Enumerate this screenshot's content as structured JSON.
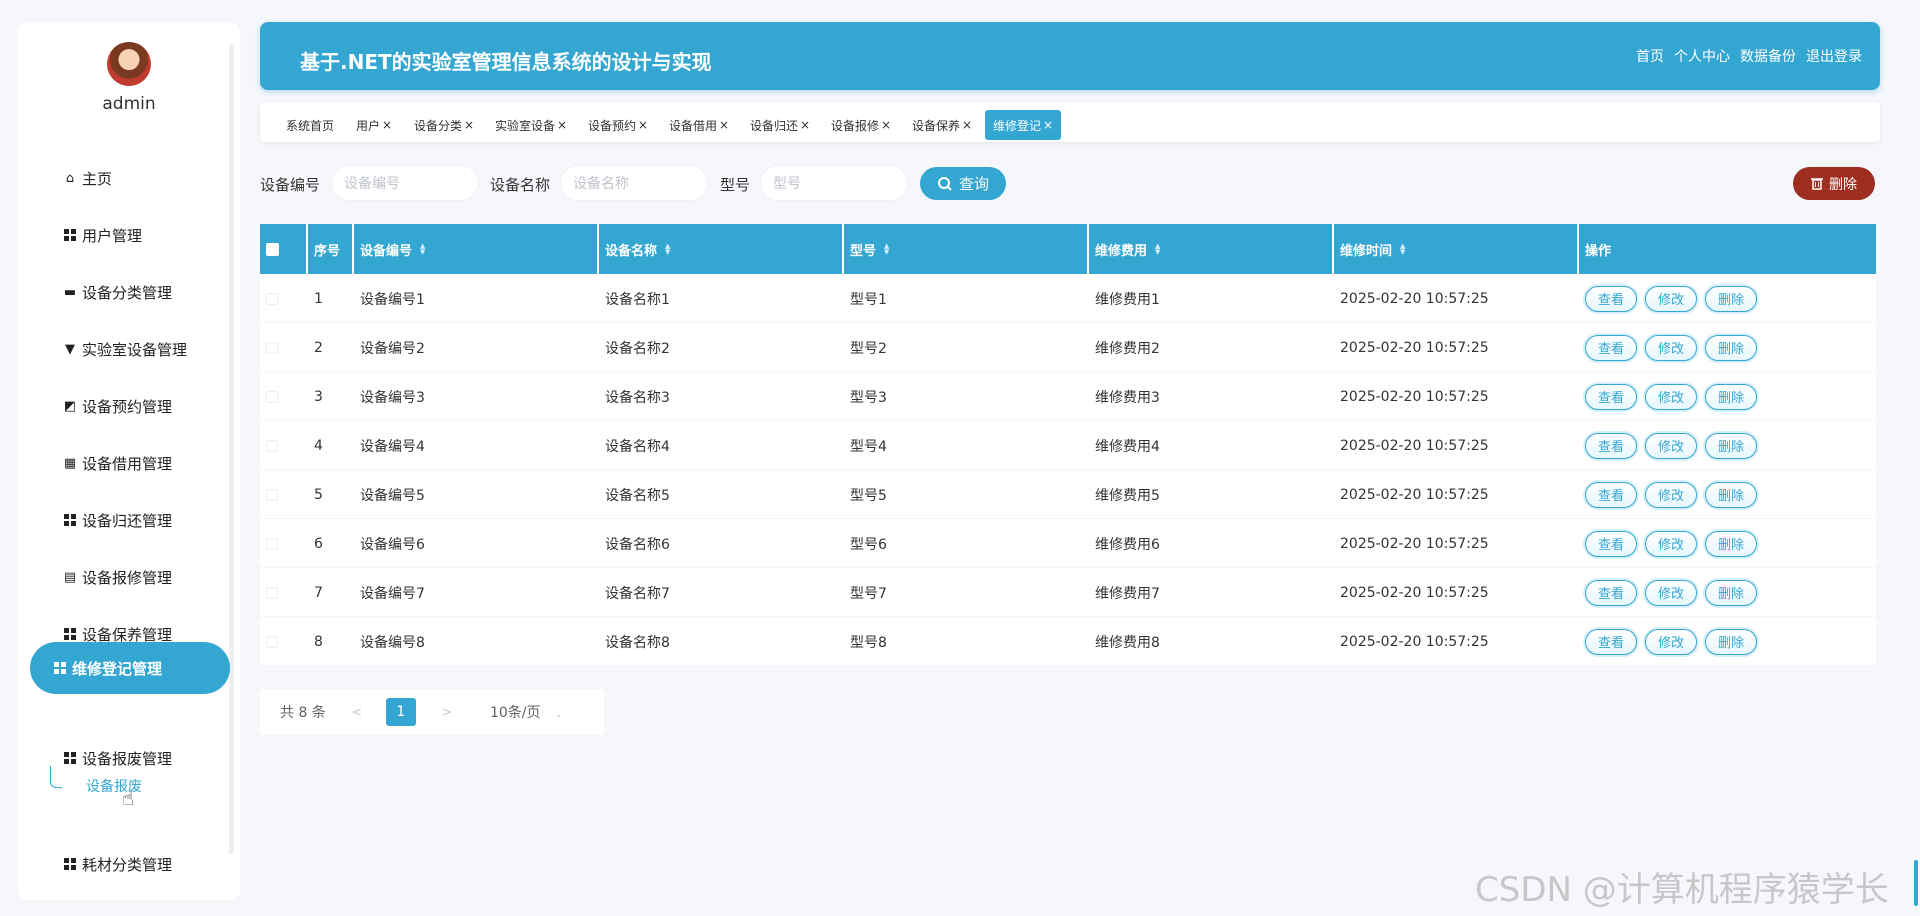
{
  "user": {
    "name": "admin"
  },
  "sidebar": {
    "items": [
      {
        "label": "主页",
        "icon": "home-icon"
      },
      {
        "label": "用户管理",
        "icon": "grid-icon"
      },
      {
        "label": "设备分类管理",
        "icon": "monitor-icon"
      },
      {
        "label": "实验室设备管理",
        "icon": "device-icon"
      },
      {
        "label": "设备预约管理",
        "icon": "chart-icon"
      },
      {
        "label": "设备借用管理",
        "icon": "grid9-icon"
      },
      {
        "label": "设备归还管理",
        "icon": "grid-icon"
      },
      {
        "label": "设备报修管理",
        "icon": "clipboard-icon"
      },
      {
        "label": "设备保养管理",
        "icon": "grid-icon"
      },
      {
        "label": "维修登记管理",
        "icon": "grid-icon",
        "active": true
      },
      {
        "label": "设备报废管理",
        "icon": "grid-icon"
      },
      {
        "label": "耗材分类管理",
        "icon": "grid-icon"
      }
    ],
    "submenu": {
      "label": "设备报废"
    }
  },
  "header": {
    "title": "基于.NET的实验室管理信息系统的设计与实现",
    "nav": [
      "首页",
      "个人中心",
      "数据备份",
      "退出登录"
    ]
  },
  "tabs": [
    {
      "label": "系统首页",
      "close": ""
    },
    {
      "label": "用户",
      "close": "×"
    },
    {
      "label": "设备分类",
      "close": "×"
    },
    {
      "label": "实验室设备",
      "close": "×"
    },
    {
      "label": "设备预约",
      "close": "×"
    },
    {
      "label": "设备借用",
      "close": "×"
    },
    {
      "label": "设备归还",
      "close": "×"
    },
    {
      "label": "设备报修",
      "close": "×"
    },
    {
      "label": "设备保养",
      "close": "×"
    },
    {
      "label": "维修登记",
      "close": "×",
      "active": true
    }
  ],
  "search": {
    "fields": [
      {
        "label": "设备编号",
        "placeholder": "设备编号"
      },
      {
        "label": "设备名称",
        "placeholder": "设备名称"
      },
      {
        "label": "型号",
        "placeholder": "型号"
      }
    ],
    "query_label": "查询",
    "delete_label": "删除"
  },
  "table": {
    "columns": [
      "序号",
      "设备编号",
      "设备名称",
      "型号",
      "维修费用",
      "维修时间",
      "操作"
    ],
    "rows": [
      [
        "1",
        "设备编号1",
        "设备名称1",
        "型号1",
        "维修费用1",
        "2025-02-20 10:57:25"
      ],
      [
        "2",
        "设备编号2",
        "设备名称2",
        "型号2",
        "维修费用2",
        "2025-02-20 10:57:25"
      ],
      [
        "3",
        "设备编号3",
        "设备名称3",
        "型号3",
        "维修费用3",
        "2025-02-20 10:57:25"
      ],
      [
        "4",
        "设备编号4",
        "设备名称4",
        "型号4",
        "维修费用4",
        "2025-02-20 10:57:25"
      ],
      [
        "5",
        "设备编号5",
        "设备名称5",
        "型号5",
        "维修费用5",
        "2025-02-20 10:57:25"
      ],
      [
        "6",
        "设备编号6",
        "设备名称6",
        "型号6",
        "维修费用6",
        "2025-02-20 10:57:25"
      ],
      [
        "7",
        "设备编号7",
        "设备名称7",
        "型号7",
        "维修费用7",
        "2025-02-20 10:57:25"
      ],
      [
        "8",
        "设备编号8",
        "设备名称8",
        "型号8",
        "维修费用8",
        "2025-02-20 10:57:25"
      ]
    ],
    "actions": [
      "查看",
      "修改",
      "删除"
    ]
  },
  "pagination": {
    "total": "共 8 条",
    "current": "1",
    "size": "10条/页",
    "prev": "<",
    "next": ">",
    "dropdown": "⌄"
  },
  "watermark": "CSDN @计算机程序猿学长",
  "colors": {
    "primary": "#34a6d2",
    "danger": "#9e2e20"
  }
}
